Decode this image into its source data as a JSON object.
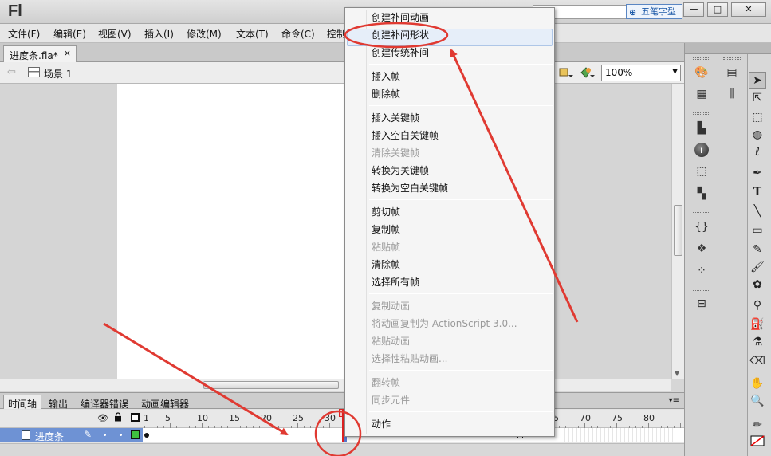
{
  "app": {
    "logo": "Fl",
    "ime_badge": "五笔字型",
    "window_controls": [
      "—",
      "□",
      "✕"
    ]
  },
  "menubar": [
    "文件(F)",
    "编辑(E)",
    "视图(V)",
    "插入(I)",
    "修改(M)",
    "文本(T)",
    "命令(C)",
    "控制"
  ],
  "document_tab": {
    "label": "进度条.fla*",
    "close": "×"
  },
  "editbar": {
    "scene": "场景 1",
    "zoom": "100%"
  },
  "timeline": {
    "tabs": [
      "时间轴",
      "输出",
      "编译器错误",
      "动画编辑器"
    ],
    "ruler_labels": [
      "1",
      "5",
      "10",
      "15",
      "20",
      "25",
      "30",
      "65",
      "70",
      "75",
      "80"
    ],
    "layer_name": "进度条"
  },
  "context_menu": {
    "items": [
      {
        "label": "创建补间动画",
        "enabled": true
      },
      {
        "label": "创建补间形状",
        "enabled": true,
        "highlighted": true
      },
      {
        "label": "创建传统补间",
        "enabled": true
      },
      {
        "label": "插入帧",
        "enabled": true
      },
      {
        "label": "删除帧",
        "enabled": true
      },
      {
        "label": "插入关键帧",
        "enabled": true
      },
      {
        "label": "插入空白关键帧",
        "enabled": true
      },
      {
        "label": "清除关键帧",
        "enabled": false
      },
      {
        "label": "转换为关键帧",
        "enabled": true
      },
      {
        "label": "转换为空白关键帧",
        "enabled": true
      },
      {
        "label": "剪切帧",
        "enabled": true
      },
      {
        "label": "复制帧",
        "enabled": true
      },
      {
        "label": "粘贴帧",
        "enabled": false
      },
      {
        "label": "清除帧",
        "enabled": true
      },
      {
        "label": "选择所有帧",
        "enabled": true
      },
      {
        "label": "复制动画",
        "enabled": false
      },
      {
        "label": "将动画复制为 ActionScript 3.0...",
        "enabled": false
      },
      {
        "label": "粘贴动画",
        "enabled": false
      },
      {
        "label": "选择性粘贴动画...",
        "enabled": false
      },
      {
        "label": "翻转帧",
        "enabled": false
      },
      {
        "label": "同步元件",
        "enabled": false
      },
      {
        "label": "动作",
        "enabled": true
      }
    ]
  },
  "icons": {
    "right_panel": [
      "palette-icon",
      "grid-icon",
      "align-icon",
      "info-icon",
      "transform-icon",
      "swatches-icon",
      "library-icon",
      "components-icon",
      "code-snippets-icon",
      "motion-presets-icon",
      "behaviors-icon",
      "project-icon",
      "movie-explorer-icon"
    ],
    "tools": [
      "selection-tool-icon",
      "subselection-tool-icon",
      "free-transform-tool-icon",
      "3d-rotation-tool-icon",
      "lasso-tool-icon",
      "pen-tool-icon",
      "text-tool-icon",
      "line-tool-icon",
      "rectangle-tool-icon",
      "pencil-tool-icon",
      "brush-tool-icon",
      "deco-tool-icon",
      "bone-tool-icon",
      "paint-bucket-tool-icon",
      "eyedropper-tool-icon",
      "eraser-tool-icon",
      "hand-tool-icon",
      "zoom-tool-icon",
      "stroke-color-icon",
      "fill-color-icon"
    ]
  },
  "colors": {
    "annotation_red": "#e03a32",
    "layer_highlight": "#6e92d4",
    "menu_hover": "#e6eef9"
  }
}
